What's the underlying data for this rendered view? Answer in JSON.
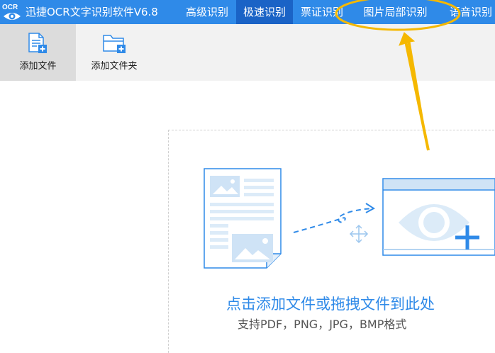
{
  "app": {
    "logo_text": "OCR",
    "title": "迅捷OCR文字识别软件V6.8"
  },
  "tabs": [
    {
      "label": "高级识别",
      "active": false
    },
    {
      "label": "极速识别",
      "active": true
    },
    {
      "label": "票证识别",
      "active": false
    },
    {
      "label": "图片局部识别",
      "active": false
    },
    {
      "label": "语音识别",
      "active": false
    }
  ],
  "toolbar": {
    "add_file_label": "添加文件",
    "add_folder_label": "添加文件夹"
  },
  "dropzone": {
    "main_text": "点击添加文件或拖拽文件到此处",
    "sub_text": "支持PDF，PNG，JPG，BMP格式"
  },
  "colors": {
    "accent": "#2f8ae8",
    "active_tab": "#1a63c6",
    "annotation": "#f5b800"
  },
  "icons": [
    "ocr-eye-logo",
    "add-file-icon",
    "add-folder-icon",
    "document-image-icon",
    "dashed-arrow-icon",
    "move-cross-icon",
    "eye-window-icon"
  ]
}
